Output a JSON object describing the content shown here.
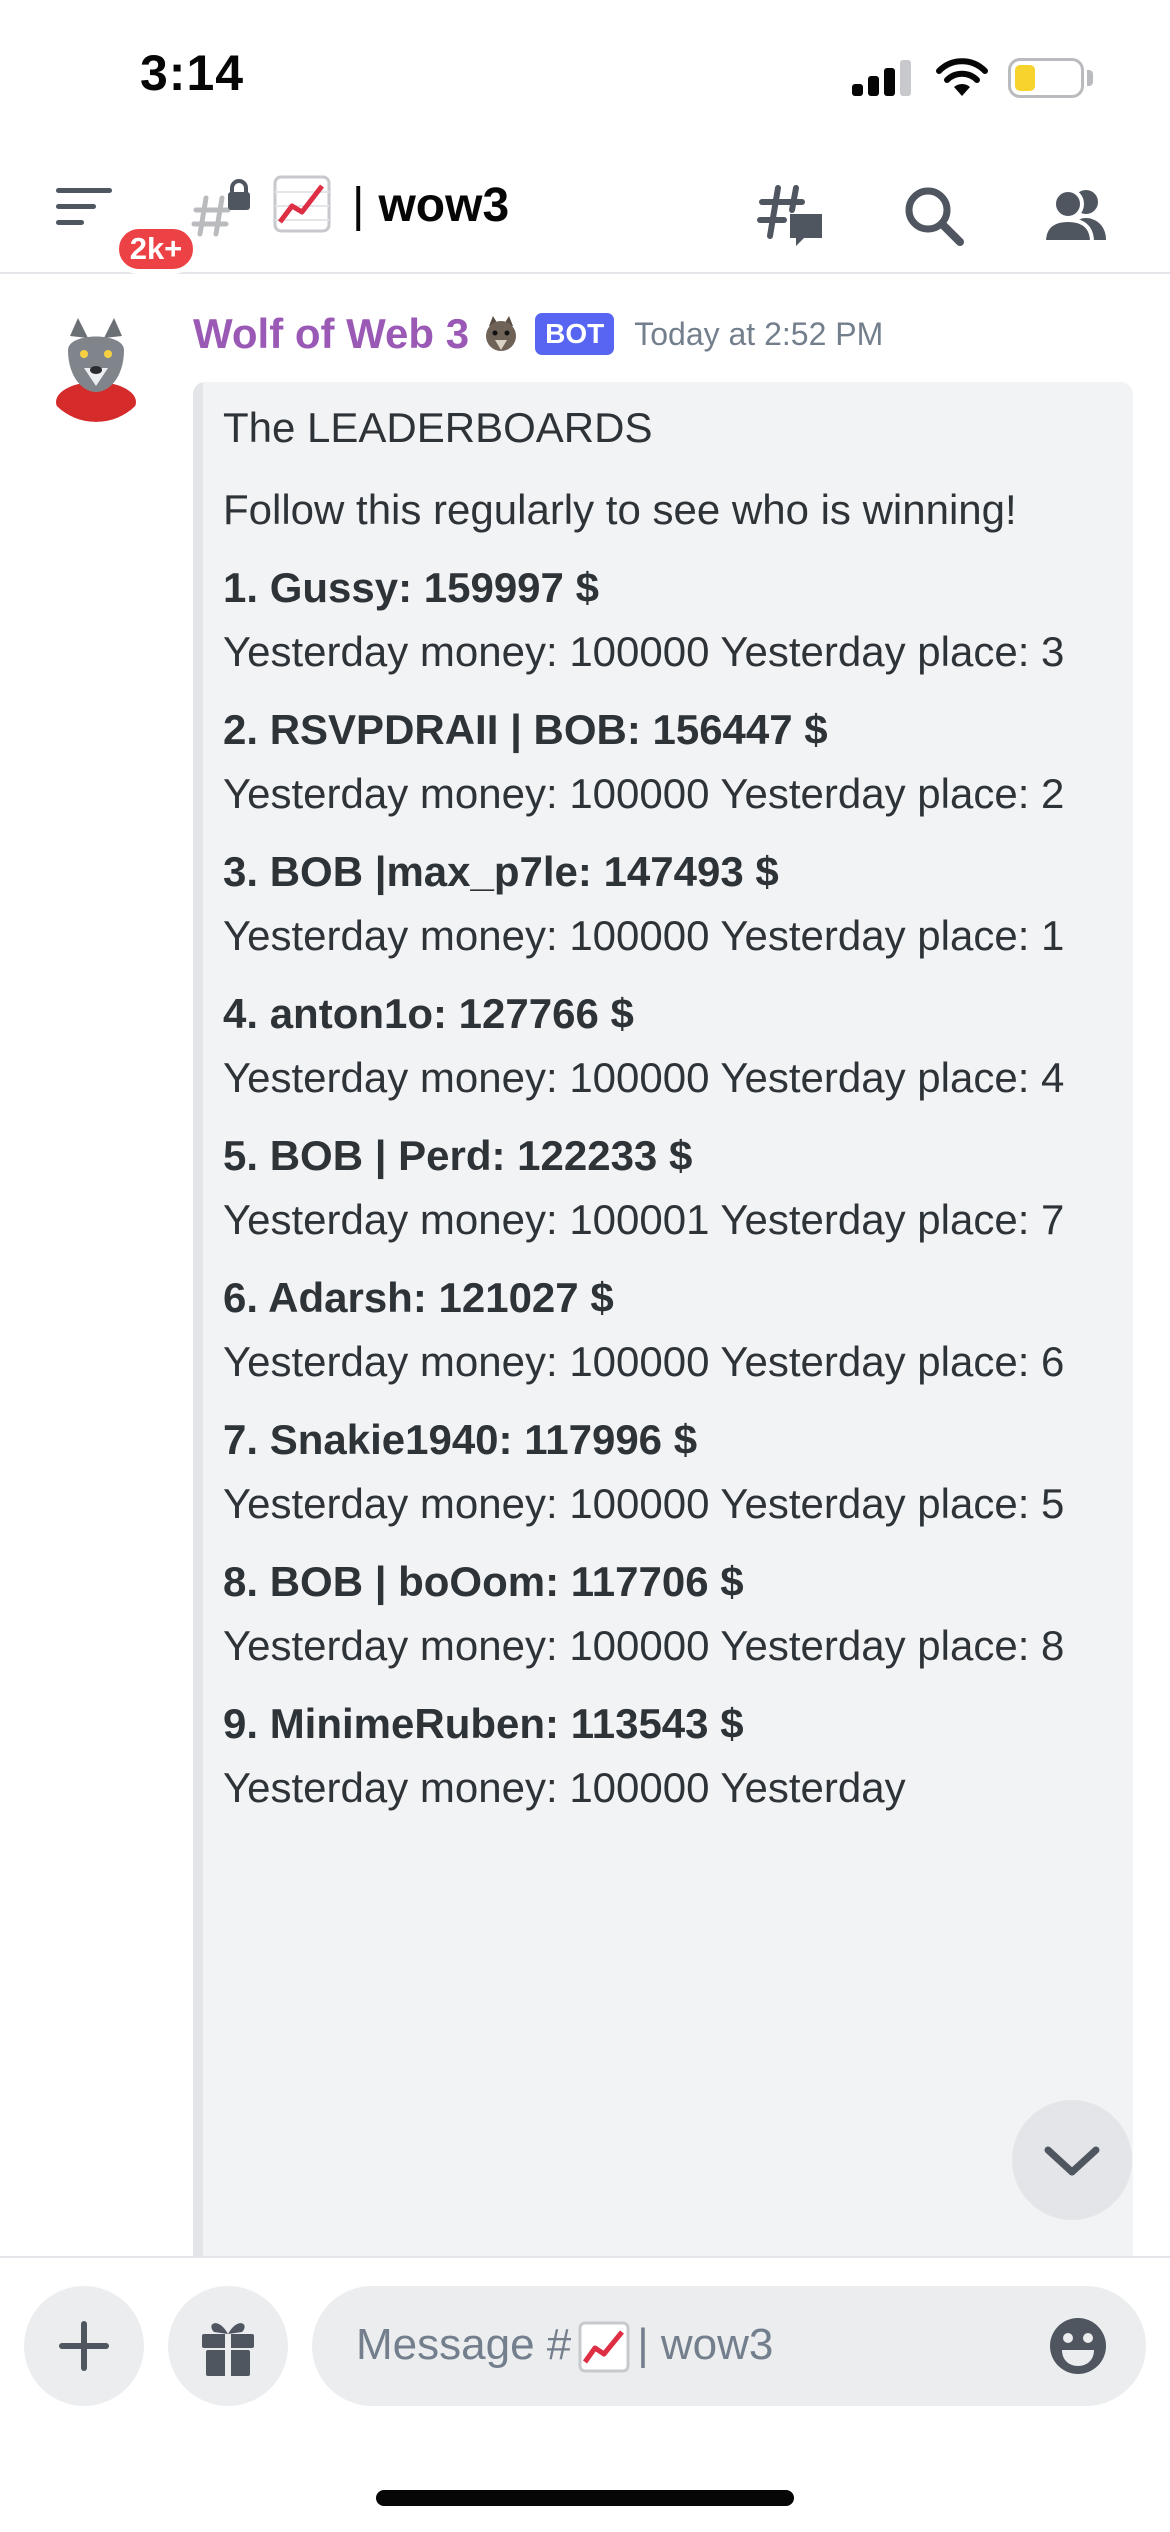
{
  "status_bar": {
    "time": "3:14"
  },
  "header": {
    "badge": "2k+",
    "channel_name": "wow3",
    "channel_separator": "|"
  },
  "message": {
    "username": "Wolf of Web 3",
    "bot_tag": "BOT",
    "timestamp": "Today at 2:52 PM",
    "embed": {
      "title": "The LEADERBOARDS",
      "description": "Follow this regularly to see who is winning!",
      "entries": [
        {
          "head": "1. Gussy: 159997 $",
          "sub": "Yesterday money:  100000 Yesterday place:  3"
        },
        {
          "head": "2. RSVPDRAII | BOB: 156447 $",
          "sub": "Yesterday money:  100000 Yesterday place:  2"
        },
        {
          "head": "3. BOB |max_p7le: 147493 $",
          "sub": "Yesterday money:  100000 Yesterday place:  1"
        },
        {
          "head": "4. anton1o: 127766 $",
          "sub": "Yesterday money:  100000 Yesterday place:  4"
        },
        {
          "head": "5. BOB | Perd: 122233 $",
          "sub": "Yesterday money:  100001 Yesterday place:  7"
        },
        {
          "head": "6. Adarsh: 121027 $",
          "sub": "Yesterday money:  100000 Yesterday place:  6"
        },
        {
          "head": "7. Snakie1940: 117996 $",
          "sub": "Yesterday money:  100000 Yesterday place:  5"
        },
        {
          "head": "8. BOB | boOom: 117706 $",
          "sub": "Yesterday money:  100000 Yesterday place:  8"
        },
        {
          "head": "9. MinimeRuben: 113543 $",
          "sub": "Yesterday money:  100000 Yesterday"
        }
      ]
    }
  },
  "composer": {
    "placeholder_prefix": "Message #",
    "placeholder_suffix": "| wow3"
  },
  "icons": {
    "menu": "hamburger-icon",
    "channel": "locked-text-channel-icon",
    "channel_emoji": "chart-increasing-emoji-icon",
    "threads": "threads-icon",
    "search": "search-icon",
    "members": "members-icon",
    "scroll_down": "chevron-down-icon",
    "add": "plus-icon",
    "gift": "gift-icon",
    "emoji": "emoji-icon"
  },
  "colors": {
    "username": "#9b59b6",
    "bot_tag": "#5865f2",
    "badge": "#ed4245",
    "embed_bg": "#f2f3f5",
    "battery": "#f6d32d"
  }
}
